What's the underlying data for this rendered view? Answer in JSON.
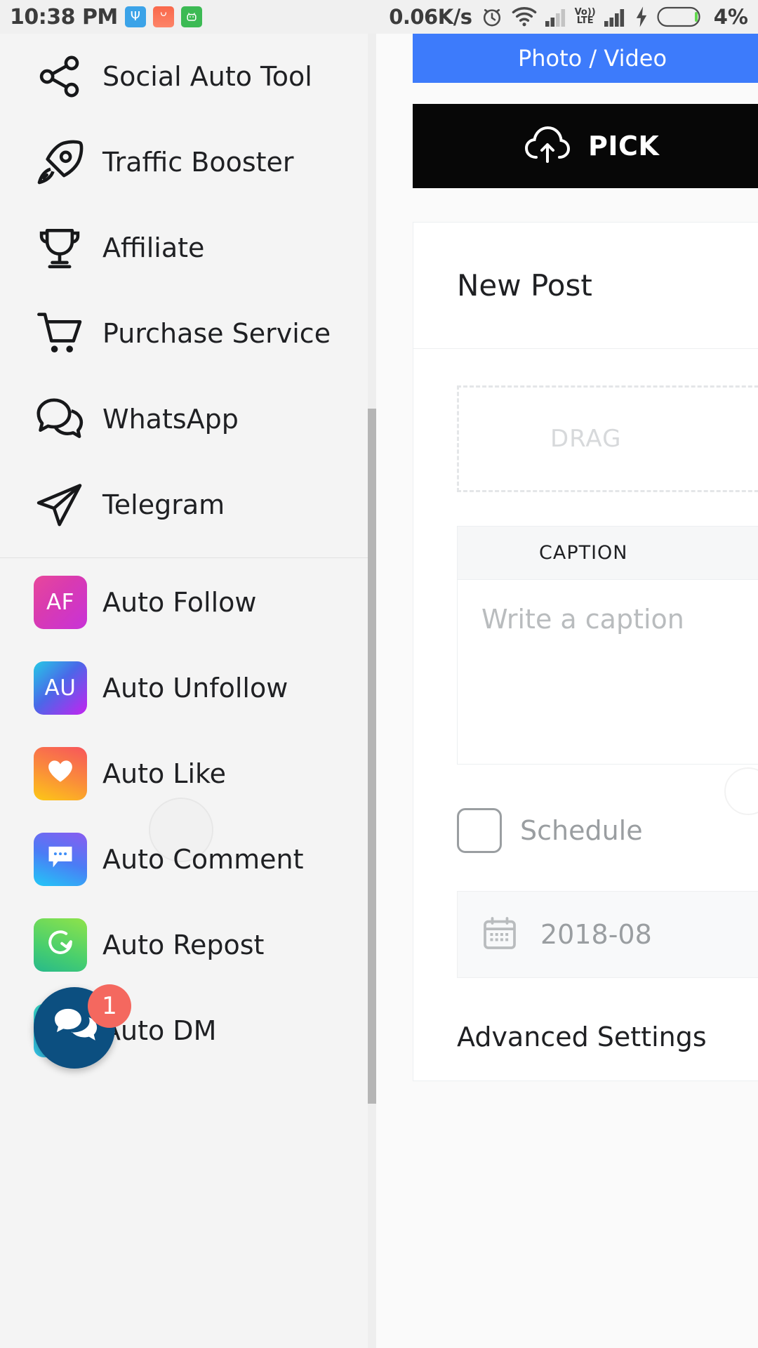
{
  "status_bar": {
    "time": "10:38 PM",
    "network_speed": "0.06K/s",
    "battery_percent": "4%",
    "volte_label_top": "Vo))",
    "volte_label_bottom": "LTE",
    "icons": [
      "usb-icon",
      "shopping-bag-icon",
      "android-robot-icon",
      "alarm-clock-icon",
      "wifi-icon",
      "signal-bars-icon",
      "volte-icon",
      "signal-bars-icon-2",
      "charging-bolt-icon",
      "battery-icon"
    ]
  },
  "drawer": {
    "items": [
      {
        "label": "Social Auto Tool",
        "icon": "share-nodes-icon"
      },
      {
        "label": "Traffic Booster",
        "icon": "rocket-icon"
      },
      {
        "label": "Affiliate",
        "icon": "trophy-icon"
      },
      {
        "label": "Purchase Service",
        "icon": "shopping-cart-icon"
      },
      {
        "label": "WhatsApp",
        "icon": "chat-bubbles-icon"
      },
      {
        "label": "Telegram",
        "icon": "paper-plane-icon"
      }
    ],
    "auto_items": [
      {
        "label": "Auto Follow",
        "badge": "AF",
        "icon": "auto-follow-tile"
      },
      {
        "label": "Auto Unfollow",
        "badge": "AU",
        "icon": "auto-unfollow-tile"
      },
      {
        "label": "Auto Like",
        "badge": "",
        "icon": "heart-tile"
      },
      {
        "label": "Auto Comment",
        "badge": "",
        "icon": "comment-tile"
      },
      {
        "label": "Auto Repost",
        "badge": "",
        "icon": "repost-tile"
      },
      {
        "label": "Auto DM",
        "badge": "",
        "icon": "dm-tile"
      }
    ]
  },
  "fab": {
    "icon": "chat-bubbles-icon",
    "badge_count": "1"
  },
  "content": {
    "tab_label": "Photo / Video",
    "pick_button_label": "PICK",
    "pick_icon": "cloud-upload-icon",
    "card_title": "New Post",
    "drag_zone_label": "DRAG",
    "caption_header": "CAPTION",
    "caption_placeholder": "Write a caption",
    "schedule_label": "Schedule",
    "schedule_checked": false,
    "date_value": "2018-08",
    "date_icon": "calendar-icon",
    "advanced_settings_label": "Advanced Settings"
  },
  "colors": {
    "tab_blue": "#3d7bfb",
    "pick_black": "#070707",
    "fab_navy": "#0c4f80",
    "badge_red": "#f4685f",
    "drawer_bg": "#f4f4f4"
  }
}
